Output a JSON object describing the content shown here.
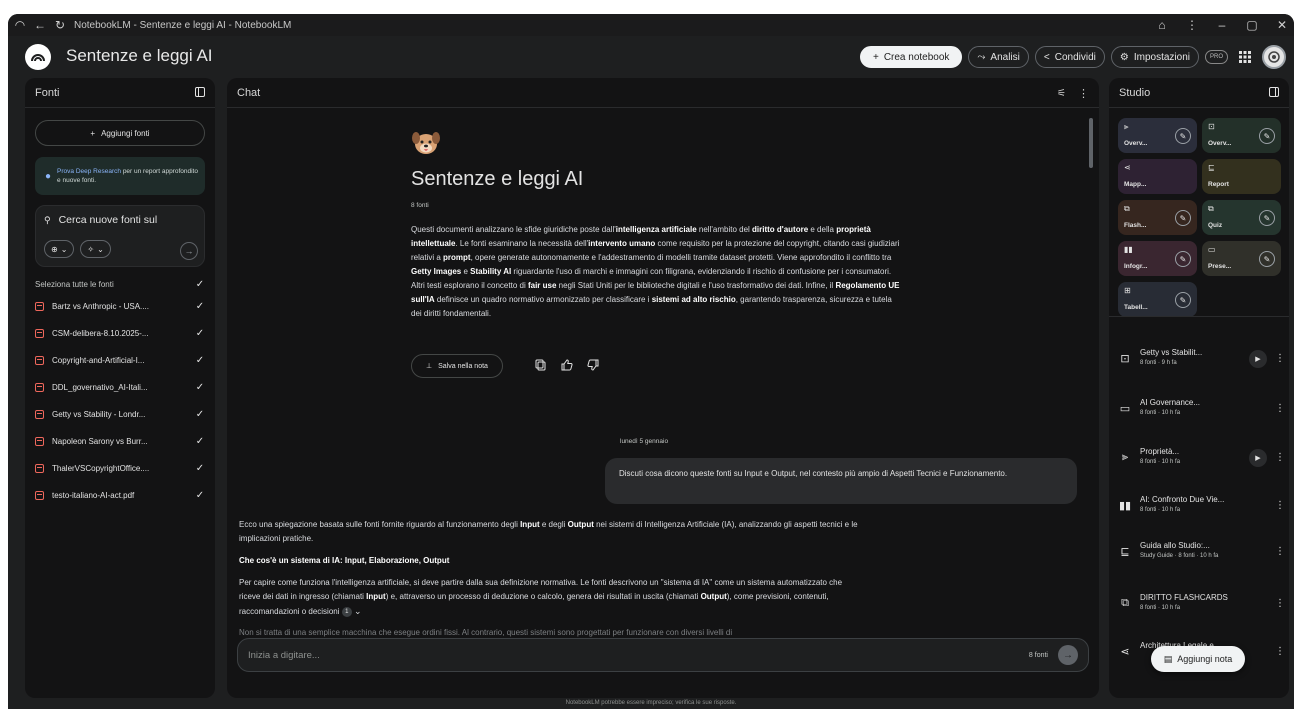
{
  "window": {
    "tab_title": "NotebookLM - Sentenze e leggi AI - NotebookLM"
  },
  "header": {
    "notebook_title": "Sentenze e leggi AI",
    "create_label": "Crea notebook",
    "analytics_label": "Analisi",
    "share_label": "Condividi",
    "settings_label": "Impostazioni",
    "pro_badge": "PRO"
  },
  "sources": {
    "title": "Fonti",
    "add_label": "Aggiungi fonti",
    "promo_highlight": "Prova Deep Research",
    "promo_text": "per un report approfondito e nuove fonti.",
    "search_placeholder": "Cerca nuove fonti sul",
    "select_all_label": "Seleziona tutte le fonti",
    "items": [
      {
        "name": "Bartz vs Anthropic - USA...."
      },
      {
        "name": "CSM-delibera-8.10.2025-..."
      },
      {
        "name": "Copyright-and-Artificial-I..."
      },
      {
        "name": "DDL_governativo_AI-Itali..."
      },
      {
        "name": "Getty vs Stability - Londr..."
      },
      {
        "name": "Napoleon Sarony vs Burr..."
      },
      {
        "name": "ThalerVSCopyrightOffice...."
      },
      {
        "name": "testo-italiano-AI-act.pdf"
      }
    ]
  },
  "chat": {
    "title": "Chat",
    "notebook_title": "Sentenze e leggi AI",
    "source_count": "8 fonti",
    "save_note_label": "Salva nella nota",
    "date_label": "lunedì 5 gennaio",
    "user_message": "Discuti cosa dicono queste fonti su Input e Output, nel contesto più ampio di Aspetti Tecnici e Funzionamento.",
    "answer_heading": "Che cos'è un sistema di IA: Input, Elaborazione, Output",
    "citation_number": "1",
    "truncated_line": "Non si tratta di una semplice macchina che esegue ordini fissi. Al contrario, questi sistemi sono progettati per funzionare con diversi livelli di",
    "composer_placeholder": "Inizia a digitare...",
    "composer_count": "8 fonti"
  },
  "studio": {
    "title": "Studio",
    "tiles": [
      {
        "label": "Overv...",
        "icon": "audio-wave-icon"
      },
      {
        "label": "Overv...",
        "icon": "video-icon"
      },
      {
        "label": "Mapp...",
        "icon": "mindmap-icon"
      },
      {
        "label": "Report",
        "icon": "report-icon"
      },
      {
        "label": "Flash...",
        "icon": "flashcards-icon"
      },
      {
        "label": "Quiz",
        "icon": "quiz-icon"
      },
      {
        "label": "Infogr...",
        "icon": "infographic-icon"
      },
      {
        "label": "Prese...",
        "icon": "presentation-icon"
      },
      {
        "label": "Tabell...",
        "icon": "table-icon"
      }
    ],
    "notes": [
      {
        "title": "Getty vs Stabilit...",
        "sub": "8 fonti · 9 h fa"
      },
      {
        "title": "AI Governance...",
        "sub": "8 fonti · 10 h fa"
      },
      {
        "title": "Proprietà...",
        "sub": "8 fonti · 10 h fa"
      },
      {
        "title": "AI: Confronto Due Vie...",
        "sub": "8 fonti · 10 h fa"
      },
      {
        "title": "Guida allo Studio:...",
        "sub": "Study Guide · 8 fonti · 10 h fa"
      },
      {
        "title": "DIRITTO FLASHCARDS",
        "sub": "8 fonti · 10 h fa"
      },
      {
        "title": "Architettura Legale e...",
        "sub": ""
      }
    ],
    "add_note_label": "Aggiungi nota"
  },
  "footer": {
    "disclaimer": "NotebookLM potrebbe essere impreciso; verifica le sue risposte."
  },
  "colors": {
    "background": "#1e1f20",
    "panel": "#131314",
    "accent_blue": "#8ab4f8",
    "pdf_red": "#ee675c"
  }
}
